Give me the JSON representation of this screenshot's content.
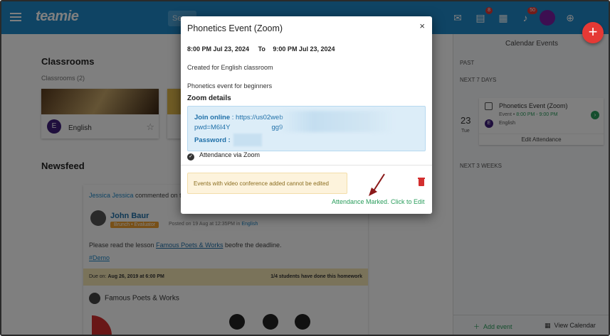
{
  "app": {
    "logo_text": "teamie",
    "search_placeholder": "Se",
    "badges": {
      "notifications_a": "8",
      "notifications_b": "50"
    }
  },
  "main": {
    "classrooms_heading": "Classrooms",
    "classrooms_count": "Classrooms (2)",
    "classroom_card": {
      "avatar_letter": "E",
      "name": "English"
    },
    "newsfeed_heading": "Newsfeed",
    "feed": {
      "actor": "Jessica Jessica",
      "activity": "commented on this",
      "poster_name": "John Baur",
      "poster_role": "Brunch • Evaluator",
      "poster_meta_prefix": "Posted on 19 Aug at 12:35PM",
      "poster_meta_in": "in",
      "poster_meta_class": "English",
      "body_before": "Please read the lesson",
      "body_link": "Famous Poets & Works",
      "body_after": "beofre the deadline.",
      "tag": "#Demo",
      "due_label": "Due on:",
      "due_date": "Aug 26, 2019 at 6:00 PM",
      "due_status": "1/4 students have done this homework",
      "resource_title": "Famous Poets & Works"
    }
  },
  "right_panel": {
    "title": "Calendar Events",
    "past": "PAST",
    "next7": "NEXT 7 DAYS",
    "next3w": "NEXT 3 WEEKS",
    "event": {
      "date": "23",
      "day": "Tue",
      "title": "Phonetics Event (Zoom)",
      "type": "Event",
      "time": "8:00 PM - 9:00 PM",
      "avatar_letter": "E",
      "classroom": "English",
      "edit_label": "Edit Attendance"
    },
    "add_event": "Add event",
    "view_calendar": "View Calendar"
  },
  "modal": {
    "title": "Phonetics Event (Zoom)",
    "close": "×",
    "start": "8:00 PM Jul 23, 2024",
    "to": "To",
    "end": "9:00 PM Jul 23, 2024",
    "created_for": "Created for English classroom",
    "description": "Phonetics event for beginners",
    "zoom_heading": "Zoom details",
    "join_label": "Join online",
    "join_url_start": ": https://us02web",
    "join_url_line2": "pwd=M6I4Y",
    "join_url_line2_end": "gg9",
    "password_label": "Password :",
    "attendance_via": "Attendance via Zoom",
    "warning": "Events with video conference added cannot be edited",
    "attendance_marked": "Attendance Marked. Click to Edit"
  },
  "colors": {
    "brand": "#1e88c9",
    "success": "#2a9d5c",
    "danger": "#d32f2f",
    "annotation_arrow": "#8b1a1a"
  },
  "icons": [
    "hamburger-icon",
    "search-icon",
    "mail-icon",
    "library-icon",
    "calendar-icon",
    "bell-icon",
    "globe-icon",
    "plus-icon",
    "star-icon",
    "close-icon",
    "check-circle-icon",
    "trash-icon",
    "home-icon",
    "chevron-right-icon"
  ]
}
